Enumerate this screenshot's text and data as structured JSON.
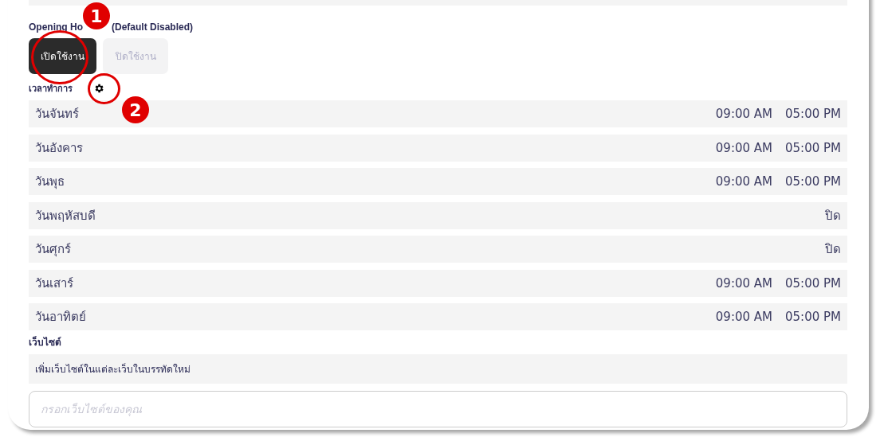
{
  "section_title": {
    "parts": [
      "Opening Ho",
      "(Default Disabled)"
    ]
  },
  "toggle_buttons": [
    {
      "label": "เปิดใช้งาน",
      "selected": true
    },
    {
      "label": "ปิดใช้งาน",
      "selected": false
    }
  ],
  "hours_label": "เวลาทำการ",
  "hours": [
    {
      "day": "วันจันทร์",
      "kind": "open",
      "open": "09:00 AM",
      "close": "05:00 PM"
    },
    {
      "day": "วันอังคาร",
      "kind": "open",
      "open": "09:00 AM",
      "close": "05:00 PM"
    },
    {
      "day": "วันพุธ",
      "kind": "open",
      "open": "09:00 AM",
      "close": "05:00 PM"
    },
    {
      "day": "วันพฤหัสบดี",
      "kind": "closed",
      "status": "ปิด"
    },
    {
      "day": "วันศุกร์",
      "kind": "closed",
      "status": "ปิด"
    },
    {
      "day": "วันเสาร์",
      "kind": "open",
      "open": "09:00 AM",
      "close": "05:00 PM"
    },
    {
      "day": "วันอาทิตย์",
      "kind": "open",
      "open": "09:00 AM",
      "close": "05:00 PM"
    }
  ],
  "website": {
    "label": "เว็บไซต์",
    "hint": "เพิ่มเว็บไซต์ในแต่ละเว็บในบรรทัดใหม่",
    "placeholder": "กรอกเว็บไซต์ของคุณ"
  },
  "annotations": [
    "1",
    "2"
  ]
}
